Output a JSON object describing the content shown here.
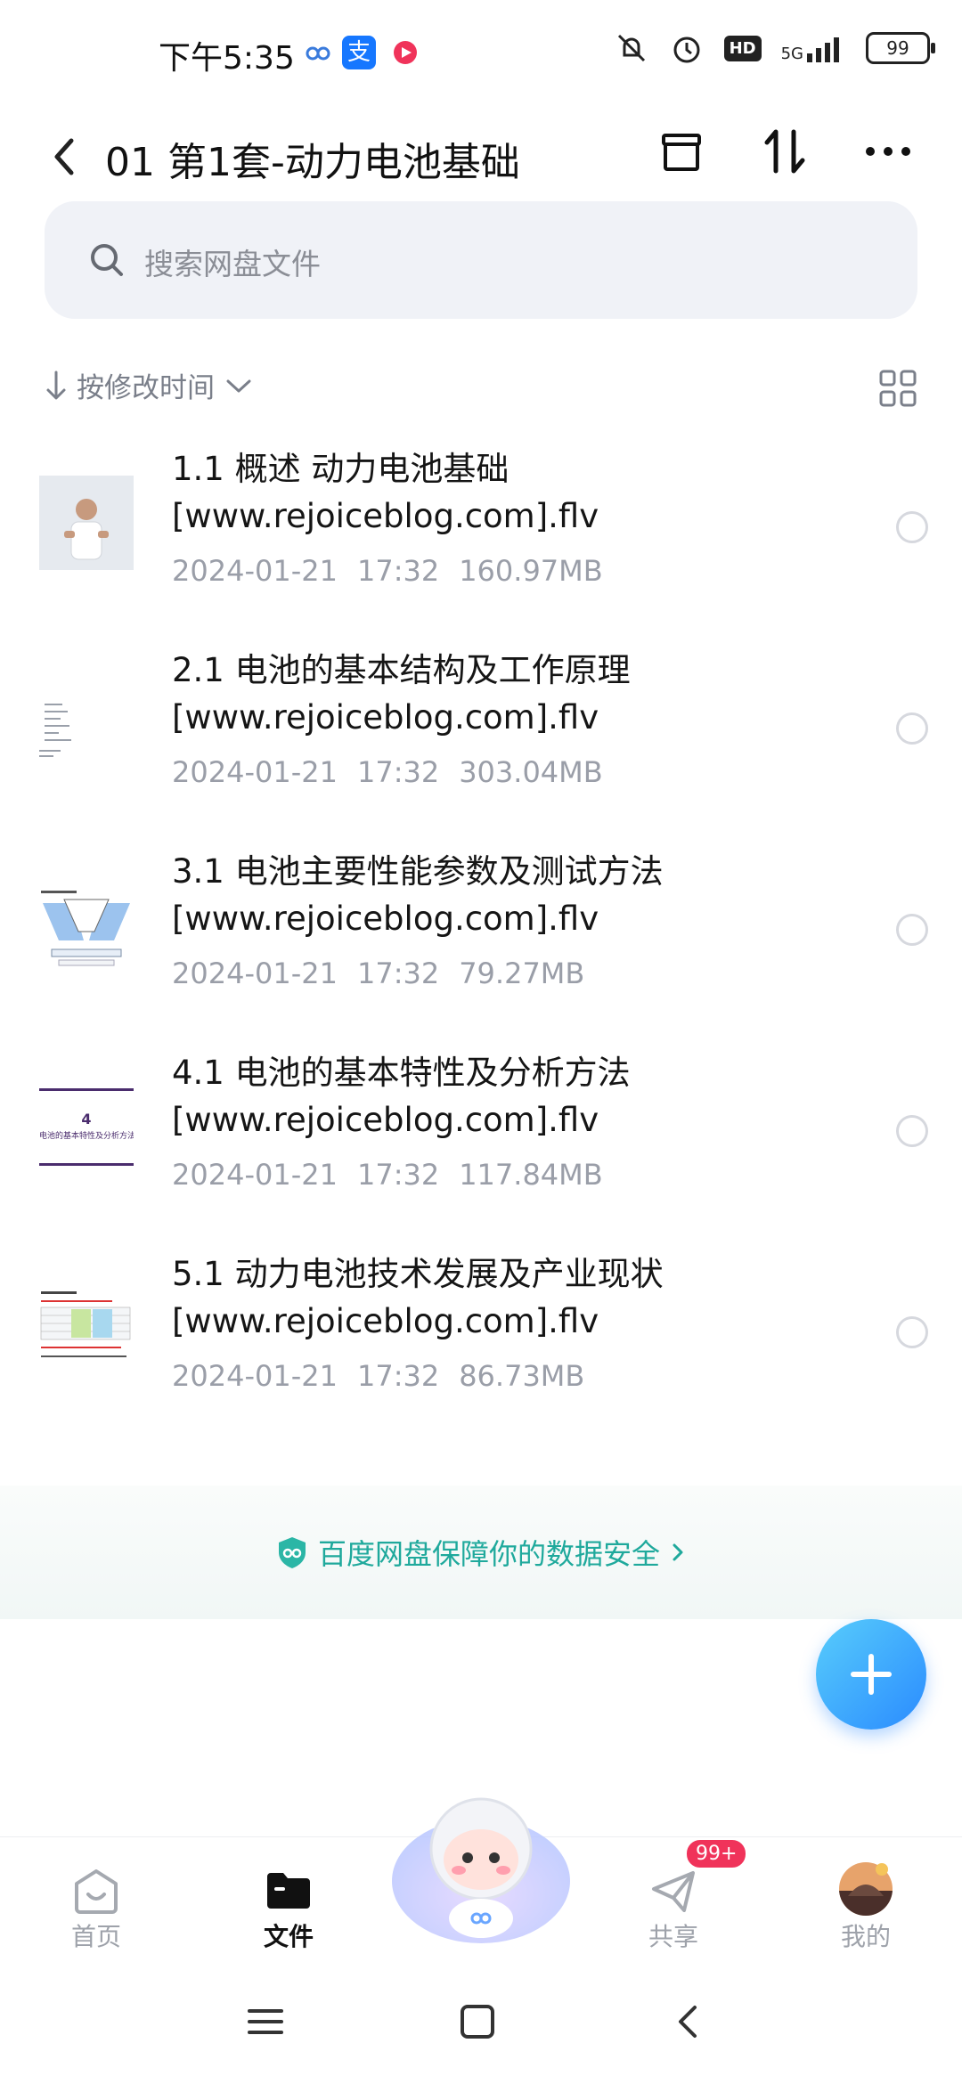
{
  "status_bar": {
    "time": "下午5:35",
    "network": "5G",
    "battery": "99",
    "hd": "HD"
  },
  "header": {
    "title": "01 第1套-动力电池基础"
  },
  "search": {
    "placeholder": "搜索网盘文件"
  },
  "sort": {
    "label": "按修改时间"
  },
  "files": [
    {
      "name": "1.1 概述 动力电池基础",
      "name2": "[www.rejoiceblog.com].flv",
      "date": "2024-01-21",
      "time": "17:32",
      "size": "160.97MB"
    },
    {
      "name": "2.1 电池的基本结构及工作原理",
      "name2": "[www.rejoiceblog.com].flv",
      "date": "2024-01-21",
      "time": "17:32",
      "size": "303.04MB"
    },
    {
      "name": "3.1 电池主要性能参数及测试方法",
      "name2": "[www.rejoiceblog.com].flv",
      "date": "2024-01-21",
      "time": "17:32",
      "size": "79.27MB"
    },
    {
      "name": "4.1 电池的基本特性及分析方法",
      "name2": "[www.rejoiceblog.com].flv",
      "date": "2024-01-21",
      "time": "17:32",
      "size": "117.84MB",
      "thumb_num": "4",
      "thumb_text": "电池的基本特性及分析方法"
    },
    {
      "name": "5.1 动力电池技术发展及产业现状",
      "name2": "[www.rejoiceblog.com].flv",
      "date": "2024-01-21",
      "time": "17:32",
      "size": "86.73MB"
    }
  ],
  "security_banner": {
    "text": "百度网盘保障你的数据安全"
  },
  "bottom_nav": {
    "home": "首页",
    "files": "文件",
    "share": "共享",
    "share_badge": "99+",
    "mine": "我的"
  },
  "colors": {
    "accent": "#1fa99c",
    "fab": "#2a8bff",
    "badge": "#f0335a"
  }
}
